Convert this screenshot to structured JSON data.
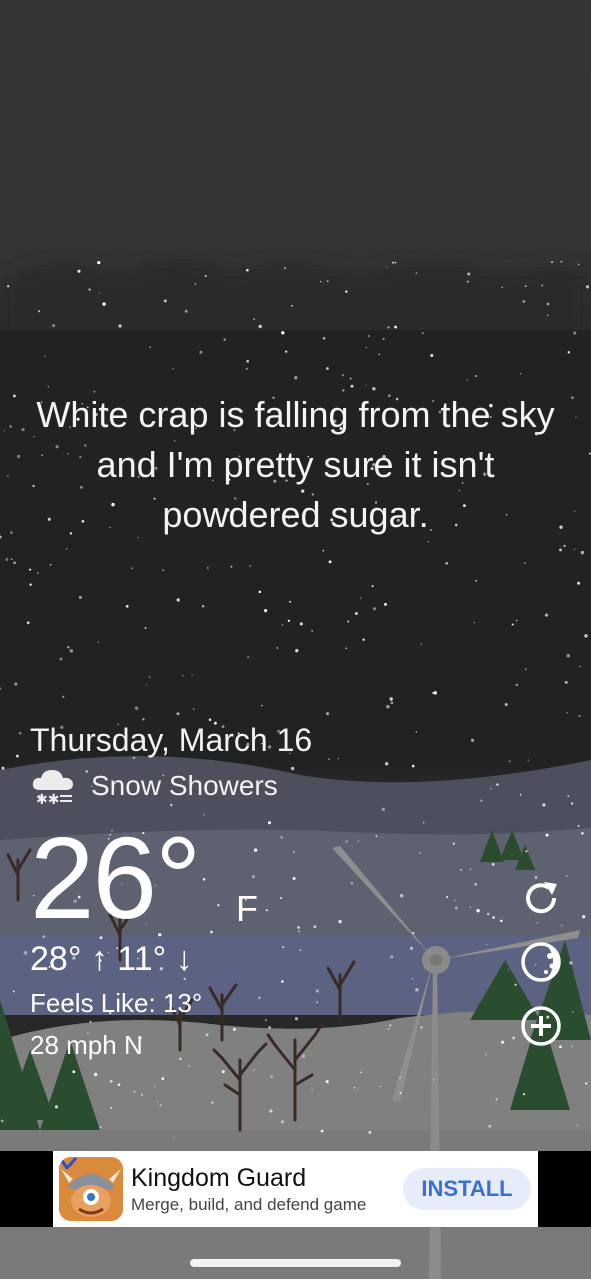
{
  "headline": "White crap is falling from the sky and I'm pretty sure it isn't powdered sugar.",
  "weather": {
    "date": "Thursday, March 16",
    "condition_icon": "snow-cloud-icon",
    "condition": "Snow Showers",
    "temperature": "26°",
    "unit": "F",
    "high_low": "28° ↑  11° ↓",
    "feels_like": "Feels Like: 13°",
    "wind": "28 mph N"
  },
  "controls": [
    {
      "icon": "refresh-icon"
    },
    {
      "icon": "moon-phase-icon"
    },
    {
      "icon": "add-circle-icon"
    }
  ],
  "ad": {
    "icon": "viking-game-icon",
    "title": "Kingdom Guard",
    "subtitle": "Merge, build, and defend game",
    "cta": "INSTALL"
  },
  "colors": {
    "sky": "#2b2b2b",
    "hills_far": "#4d4f5c",
    "lake": "#5b6282",
    "snow_ground": "#808080",
    "ad_cta_text": "#3a6fd8",
    "ad_cta_bg": "#e6ecf9"
  }
}
